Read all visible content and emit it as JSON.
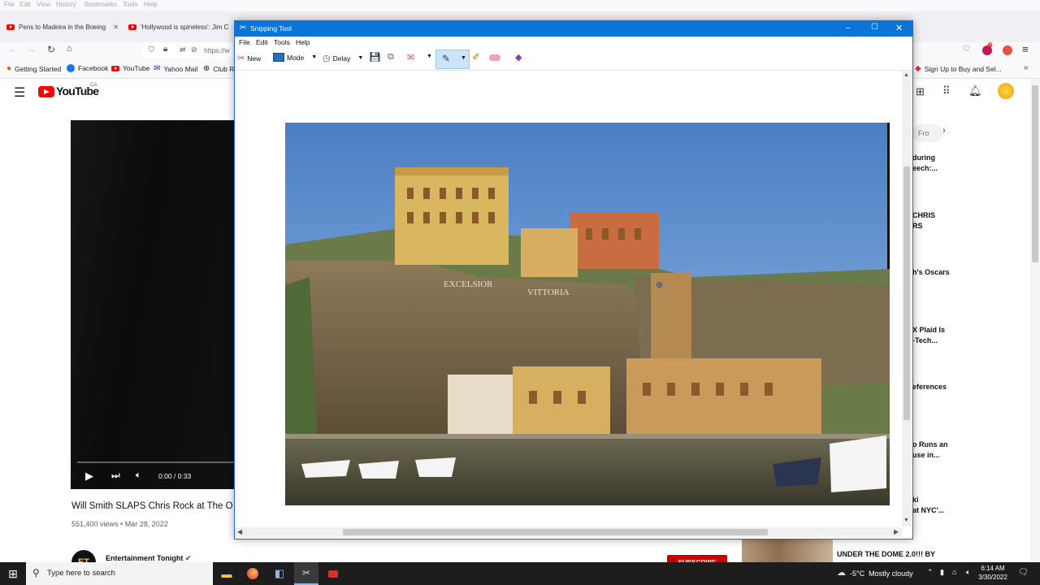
{
  "browser": {
    "menu": [
      "File",
      "Edit",
      "View",
      "History",
      "Bookmarks",
      "Tools",
      "Help"
    ],
    "tabs": [
      {
        "title": "Pens to Madeira in the Boeing"
      },
      {
        "title": "'Hollywood is spineless': Jim C"
      }
    ],
    "url_text": "https://w",
    "bookmarks": [
      "Getting Started",
      "Facebook",
      "YouTube",
      "Yahoo Mail",
      "Club R"
    ],
    "bookmark_right": "Sign Up to Buy and Sel...",
    "ext_badge": "5"
  },
  "youtube": {
    "logo_text": "YouTube",
    "logo_region": "CA",
    "video_title": "Will Smith SLAPS Chris Rock at The O",
    "video_meta": "551,400 views • Mar 28, 2022",
    "time": "0:00 / 0:33",
    "channel": "Entertainment Tonight",
    "channel_avatar": "ET",
    "subscribe": "SUBSCRIBE",
    "chip_partial": "Fro",
    "related": [
      {
        "line1": "during",
        "line2": "eech:..."
      },
      {
        "line1": "CHRIS",
        "line2": "RS"
      },
      {
        "line1": "h's Oscars",
        "line2": ""
      },
      {
        "line1": "X Plaid Is",
        "line2": "-Tech..."
      },
      {
        "line1": "eferences",
        "line2": ""
      },
      {
        "line1": "o Runs an",
        "line2": "use in..."
      },
      {
        "line1": "ki",
        "line2": "at NYC'..."
      }
    ],
    "related_bottom": "UNDER THE DOME 2.0!!! BY"
  },
  "snipping_tool": {
    "title": "Snipping Tool",
    "menu": [
      "File",
      "Edit",
      "Tools",
      "Help"
    ],
    "toolbar": {
      "new": "New",
      "mode": "Mode",
      "delay": "Delay"
    },
    "image_text": {
      "sign1": "EXCELSIOR",
      "sign2": "VITTORIA"
    }
  },
  "taskbar": {
    "search_placeholder": "Type here to search",
    "weather": "-5°C  Mostly cloudy",
    "time": "6:14 AM",
    "date": "3/30/2022"
  }
}
